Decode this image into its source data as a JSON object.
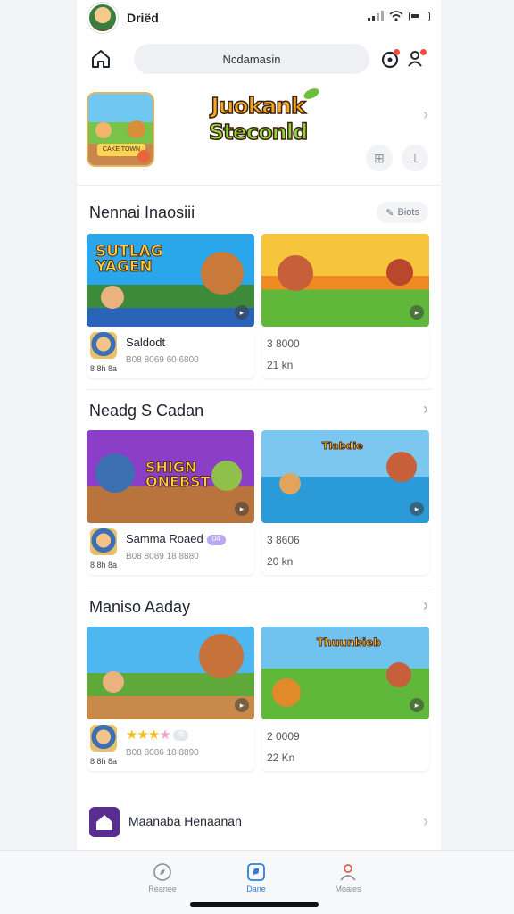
{
  "status": {
    "name": "Driëd"
  },
  "topbar": {
    "search_text": "Ncdamasin"
  },
  "hero": {
    "logo_line1": "Juokank",
    "logo_line2": "Steconld",
    "thumb_label": "CAKE TOWN"
  },
  "sections": [
    {
      "title": "Nennai Inaosiii",
      "action_label": "Biots",
      "cards": [
        {
          "art_text": "SUTLAG\nYAGEN",
          "name": "Saldodt",
          "sub": "B08 8069 60 6800",
          "small": "8 8h 8a"
        },
        {
          "r1": "3 8000",
          "r2": "21 kn"
        }
      ]
    },
    {
      "title": "Neadg S Cadan",
      "cards": [
        {
          "art_text": "SHIGN\nONEBST",
          "name": "Samma Roaed",
          "tag": "04",
          "sub": "B08 8089 18 8880",
          "small": "8 8h 8a"
        },
        {
          "art_text": "Tlabdie",
          "r1": "3 8606",
          "r2": "20 kn"
        }
      ]
    },
    {
      "title": "Maniso Aaday",
      "cards": [
        {
          "stars": "★★★",
          "star_off": "★",
          "count": "48",
          "sub": "B08 8086 18 8890",
          "small": "8 8h 8a"
        },
        {
          "art_text": "Thuunbieb",
          "r1": "2 0009",
          "r2": "22 Kn"
        }
      ]
    }
  ],
  "bottom_item": {
    "label": "Maanaba Henaanan"
  },
  "tabs": [
    {
      "label": "Reanee"
    },
    {
      "label": "Dane"
    },
    {
      "label": "Moaies"
    }
  ],
  "colors": {
    "accent": "#2f7de0",
    "notify": "#f24b3c"
  }
}
